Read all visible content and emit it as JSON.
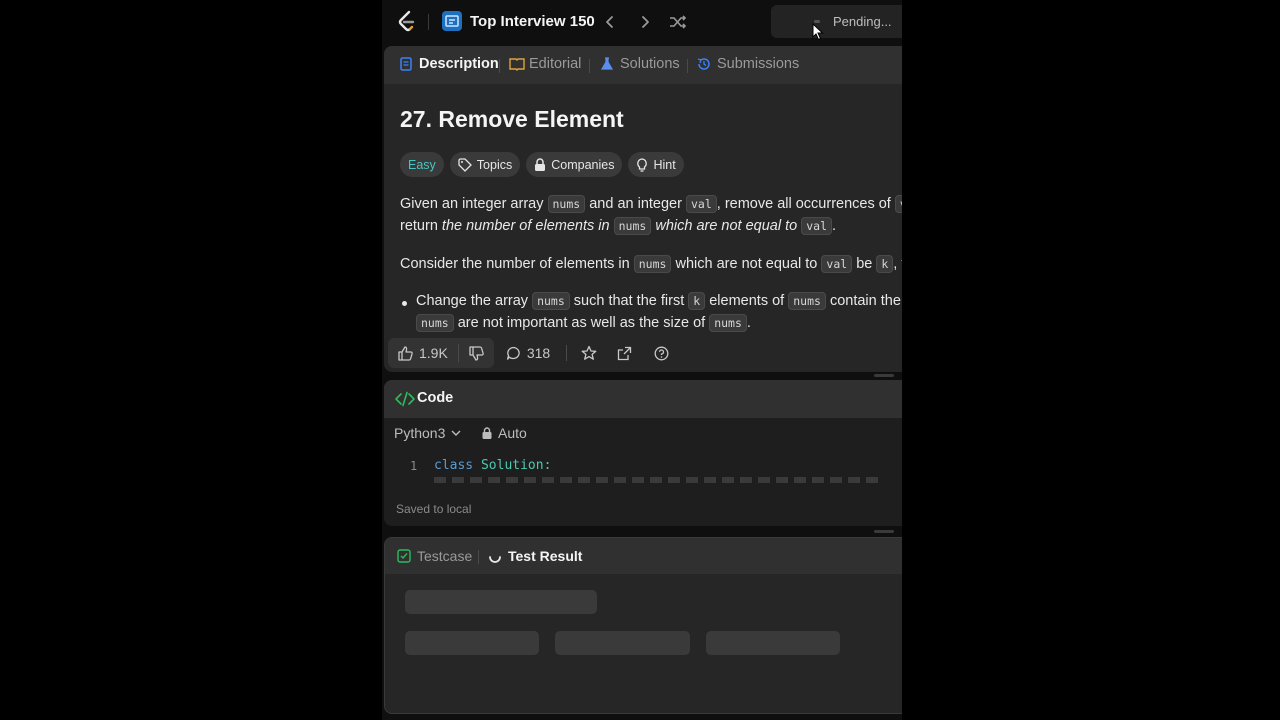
{
  "nav": {
    "list_title": "Top Interview 150",
    "status": "Pending..."
  },
  "tabs": {
    "description": "Description",
    "editorial": "Editorial",
    "solutions": "Solutions",
    "submissions": "Submissions"
  },
  "problem": {
    "title": "27. Remove Element",
    "tags": {
      "difficulty": "Easy",
      "topics": "Topics",
      "companies": "Companies",
      "hint": "Hint"
    },
    "p1_line1": {
      "t1": "Given an integer array ",
      "c1": "nums",
      "t2": " and an integer ",
      "c2": "val",
      "t3": ", remove all occurrences of ",
      "c3": "val"
    },
    "p1_line2": {
      "t1": "return ",
      "e1": "the number of elements in ",
      "c1": "nums",
      "e2": " which are not equal to ",
      "c2": "val",
      "t2": "."
    },
    "p2": {
      "t1": "Consider the number of elements in ",
      "c1": "nums",
      "t2": " which are not equal to ",
      "c2": "val",
      "t3": " be ",
      "c3": "k",
      "t4": ", to"
    },
    "bullet_line1": {
      "t1": "Change the array ",
      "c1": "nums",
      "t2": " such that the first ",
      "c2": "k",
      "t3": " elements of ",
      "c3": "nums",
      "t4": " contain the el"
    },
    "bullet_line2": {
      "c1": "nums",
      "t1": " are not important as well as the size of ",
      "c2": "nums",
      "t2": "."
    }
  },
  "actions": {
    "likes": "1.9K",
    "comments": "318"
  },
  "code": {
    "title": "Code",
    "language": "Python3",
    "mode": "Auto",
    "line_number": "1",
    "keyword": "class",
    "class_name": "Solution:",
    "saved": "Saved to local"
  },
  "test": {
    "testcase_label": "Testcase",
    "result_label": "Test Result"
  },
  "colors": {
    "easy": "#46c6c2",
    "accent_code": "#2cbb5d",
    "description_icon": "#3b82f6",
    "editorial_icon": "#e0a33a",
    "solutions_icon": "#5b8def",
    "submissions_icon": "#3b82f6"
  },
  "icons": [
    "leetcode-logo-icon",
    "study-plan-icon",
    "chevron-left-icon",
    "chevron-right-icon",
    "shuffle-icon",
    "thumbs-up-icon",
    "thumbs-down-icon",
    "comment-icon",
    "star-icon",
    "share-icon",
    "help-icon",
    "code-icon",
    "lock-icon",
    "checkbox-icon",
    "spinner-icon"
  ]
}
